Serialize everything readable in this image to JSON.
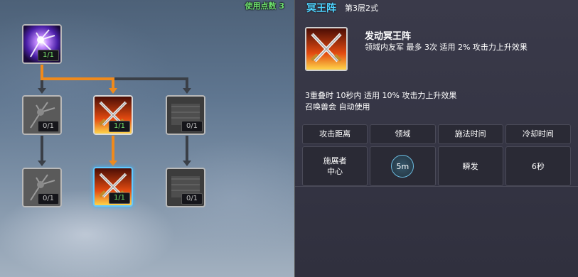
{
  "tree": {
    "used_points_label": "使用点数 3",
    "skills": [
      {
        "id": "top",
        "level": "1/1",
        "state": "maxed"
      },
      {
        "id": "r2-left",
        "level": "0/1",
        "state": "locked"
      },
      {
        "id": "r2-mid",
        "level": "1/1",
        "state": "maxed"
      },
      {
        "id": "r2-right",
        "level": "0/1",
        "state": "locked"
      },
      {
        "id": "r3-left",
        "level": "0/1",
        "state": "locked"
      },
      {
        "id": "r3-mid",
        "level": "1/1",
        "state": "maxed",
        "selected": true
      },
      {
        "id": "r3-right",
        "level": "0/1",
        "state": "locked"
      }
    ],
    "active_path_color": "#f08a1c",
    "locked_path_color": "#3a3f47",
    "selected_border_color": "#62c9ff"
  },
  "detail": {
    "title": "冥王阵",
    "stage": "第3层2式",
    "effect_title": "发动冥王阵",
    "effect_desc": "领域内友军 最多 3次 适用 2% 攻击力上升效果",
    "sub_lines": [
      "3重叠时 10秒内 适用 10% 攻击力上升效果",
      "召唤兽会 自动使用"
    ],
    "table": {
      "headers": [
        "攻击距离",
        "领域",
        "施法时间",
        "冷却时间"
      ],
      "values": {
        "distance_line1": "施展者",
        "distance_line2": "中心",
        "domain": "5m",
        "cast": "瞬发",
        "cooldown": "6秒"
      }
    },
    "title_color": "#4fd3ff"
  }
}
